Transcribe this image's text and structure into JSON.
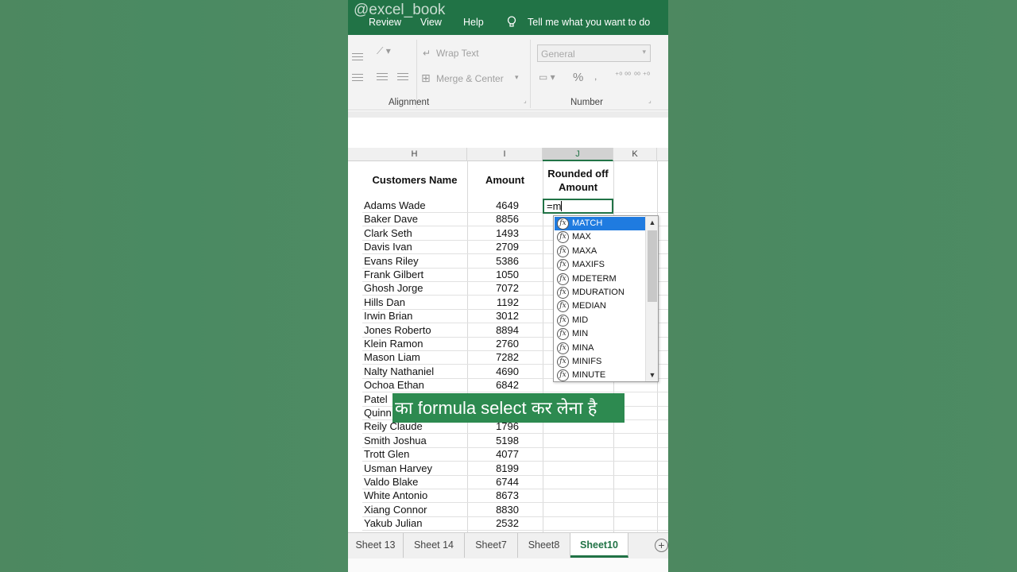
{
  "watermark": "@excel_book",
  "menu": {
    "review": "Review",
    "view": "View",
    "help": "Help",
    "tell_me": "Tell me what you want to do"
  },
  "ribbon": {
    "wrap_text": "Wrap Text",
    "merge_center": "Merge & Center",
    "number_format": "General",
    "percent": "%",
    "comma": ",",
    "alignment_label": "Alignment",
    "number_label": "Number"
  },
  "columns": [
    "H",
    "I",
    "J",
    "K"
  ],
  "headers": {
    "customers_name": "Customers Name",
    "amount": "Amount",
    "rounded_line1": "Rounded off",
    "rounded_line2": "Amount"
  },
  "rows": [
    {
      "name": "Adams Wade",
      "amount": "4649"
    },
    {
      "name": "Baker Dave",
      "amount": "8856"
    },
    {
      "name": "Clark Seth",
      "amount": "1493"
    },
    {
      "name": "Davis Ivan",
      "amount": "2709"
    },
    {
      "name": "Evans Riley",
      "amount": "5386"
    },
    {
      "name": "Frank Gilbert",
      "amount": "1050"
    },
    {
      "name": "Ghosh Jorge",
      "amount": "7072"
    },
    {
      "name": "Hills Dan",
      "amount": "1192"
    },
    {
      "name": "Irwin Brian",
      "amount": "3012"
    },
    {
      "name": "Jones Roberto",
      "amount": "8894"
    },
    {
      "name": "Klein Ramon",
      "amount": "2760"
    },
    {
      "name": "Mason Liam",
      "amount": "7282"
    },
    {
      "name": "Nalty Nathaniel",
      "amount": "4690"
    },
    {
      "name": "Ochoa Ethan",
      "amount": "6842"
    },
    {
      "name": "Patel",
      "amount": ""
    },
    {
      "name": "Quinn",
      "amount": ""
    },
    {
      "name": "Reily Claude",
      "amount": "1796"
    },
    {
      "name": "Smith Joshua",
      "amount": "5198"
    },
    {
      "name": "Trott Glen",
      "amount": "4077"
    },
    {
      "name": "Usman Harvey",
      "amount": "8199"
    },
    {
      "name": "Valdo Blake",
      "amount": "6744"
    },
    {
      "name": "White Antonio",
      "amount": "8673"
    },
    {
      "name": "Xiang Connor",
      "amount": "8830"
    },
    {
      "name": "Yakub Julian",
      "amount": "2532"
    }
  ],
  "active_cell_value": "=m",
  "autocomplete": {
    "icon_text": "fx",
    "items": [
      "MATCH",
      "MAX",
      "MAXA",
      "MAXIFS",
      "MDETERM",
      "MDURATION",
      "MEDIAN",
      "MID",
      "MIN",
      "MINA",
      "MINIFS",
      "MINUTE"
    ],
    "selected_index": 0
  },
  "caption": "का formula select कर लेना है",
  "sheet_tabs": [
    "Sheet 13",
    "Sheet 14",
    "Sheet7",
    "Sheet8",
    "Sheet10"
  ],
  "active_sheet": "Sheet10",
  "add_sheet_symbol": "+",
  "colors": {
    "excel_green": "#217346",
    "background": "#4f8a63",
    "selection_blue": "#1f7be0"
  }
}
